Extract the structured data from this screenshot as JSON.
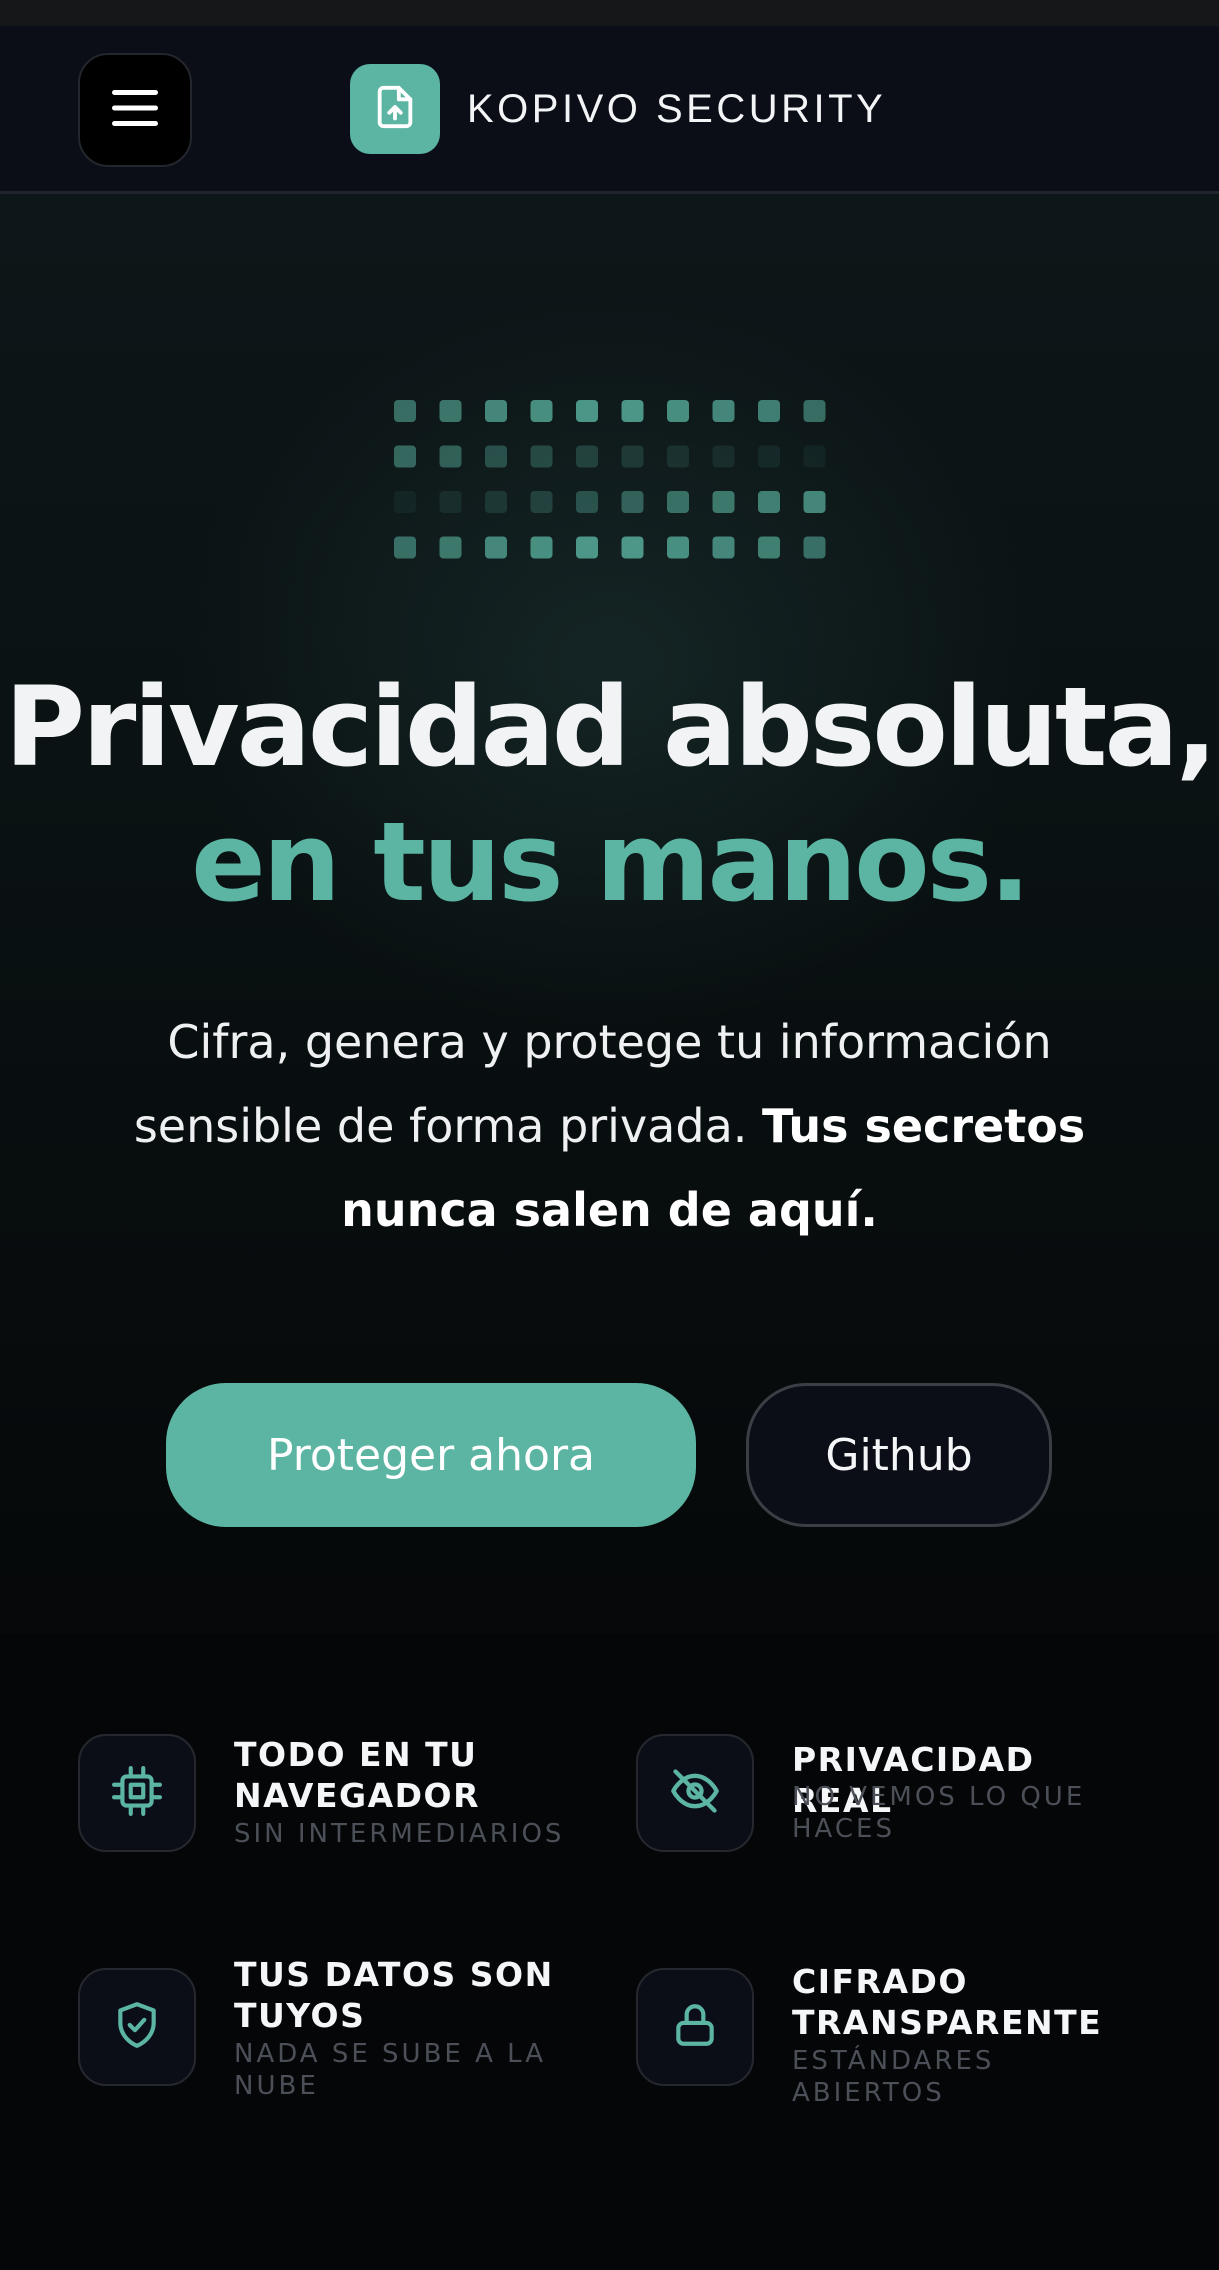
{
  "header": {
    "brand_name": "KOPIVO SECURITY",
    "menu_icon": "hamburger-menu-icon",
    "logo_icon": "file-upload-icon"
  },
  "hero": {
    "title_line1": "Privacidad absoluta,",
    "title_line2": "en tus manos.",
    "subtitle_plain": "Cifra, genera y protege tu información sensible de forma privada.",
    "subtitle_bold": "Tus secretos nunca salen de aquí.",
    "primary_button": "Proteger ahora",
    "secondary_button": "Github"
  },
  "features": [
    {
      "title": "TODO EN TU NAVEGADOR",
      "subtitle": "SIN INTERMEDIARIOS",
      "icon": "cpu-chip-icon"
    },
    {
      "title": "PRIVACIDAD REAL",
      "subtitle": "NO VEMOS LO QUE HACES",
      "icon": "eye-off-icon"
    },
    {
      "title": "TUS DATOS SON TUYOS",
      "subtitle": "NADA SE SUBE A LA NUBE",
      "icon": "shield-check-icon"
    },
    {
      "title": "CIFRADO TRANSPARENTE",
      "subtitle": "ESTÁNDARES ABIERTOS",
      "icon": "lock-icon"
    }
  ],
  "colors": {
    "accent": "#5bb5a2",
    "background": "#050607",
    "header_bg": "#0b0e17",
    "muted_text": "#4b5058"
  }
}
